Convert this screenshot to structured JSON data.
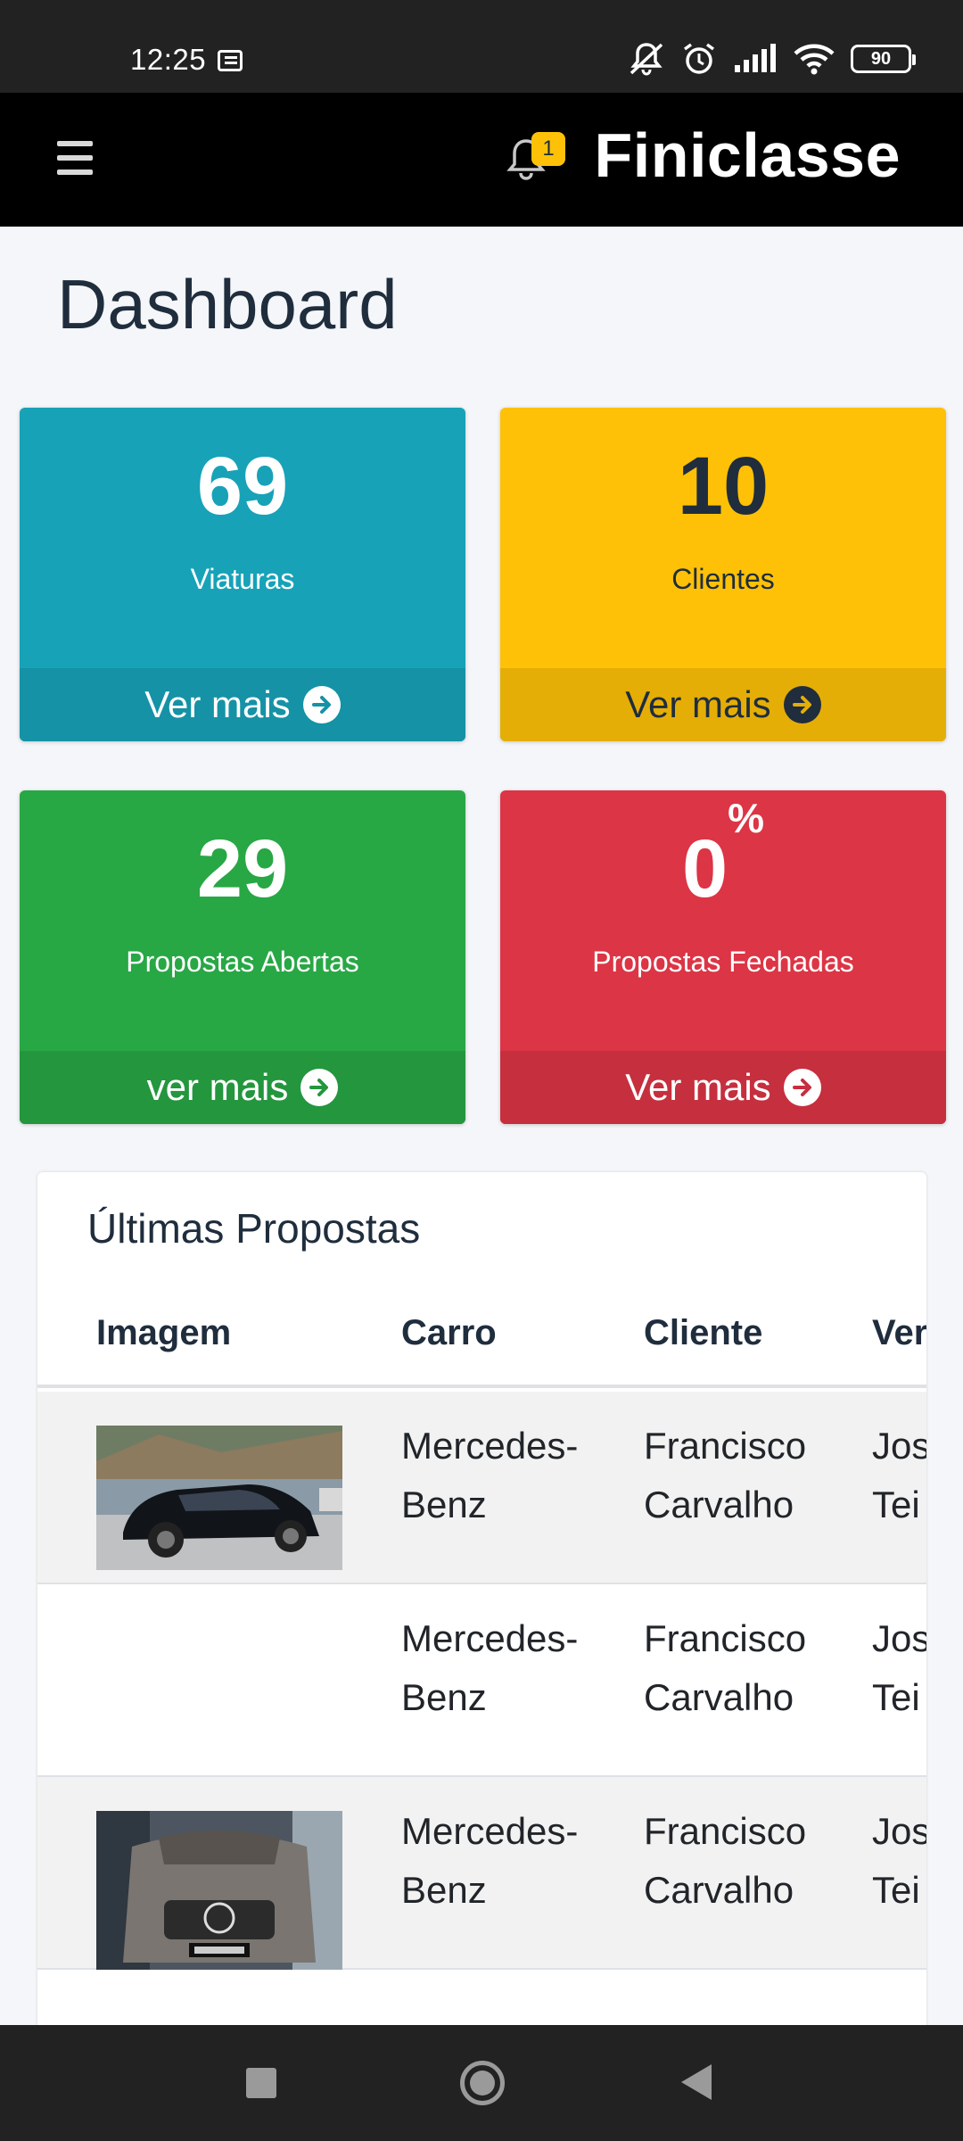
{
  "status_bar": {
    "time": "12:25",
    "battery": "90",
    "icons": [
      "notification-icon",
      "mute-icon",
      "alarm-icon",
      "signal-icon",
      "wifi-icon",
      "battery-icon"
    ]
  },
  "navbar": {
    "brand": "Finiclasse",
    "notification_count": "1",
    "menu_icon": "hamburger-icon",
    "bell_icon": "bell-icon"
  },
  "page": {
    "title": "Dashboard"
  },
  "stats": [
    {
      "value": "69",
      "label": "Viaturas",
      "link": "Ver mais",
      "color": "#17a2b8"
    },
    {
      "value": "10",
      "label": "Clientes",
      "link": "Ver mais",
      "color": "#ffc107"
    },
    {
      "value": "29",
      "label": "Propostas Abertas",
      "link": "ver mais",
      "color": "#28a745"
    },
    {
      "value": "0",
      "suffix": "%",
      "label": "Propostas Fechadas",
      "link": "Ver mais",
      "color": "#dc3545"
    }
  ],
  "latest": {
    "title": "Últimas Propostas",
    "columns": [
      "Imagem",
      "Carro",
      "Cliente",
      "Ver"
    ],
    "rows": [
      {
        "image": "car-photo-black-suv",
        "car": "Mercedes-\nBenz",
        "client": "Francisco\nCarvalho",
        "seller": "Jos\nTei"
      },
      {
        "image": "",
        "car": "Mercedes-\nBenz",
        "client": "Francisco\nCarvalho",
        "seller": "Jos\nTei"
      },
      {
        "image": "car-photo-grey-sedan",
        "car": "Mercedes-\nBenz",
        "client": "Francisco\nCarvalho",
        "seller": "Jos\nTei"
      }
    ]
  },
  "system_nav": [
    "recents-button",
    "home-button",
    "back-button"
  ]
}
